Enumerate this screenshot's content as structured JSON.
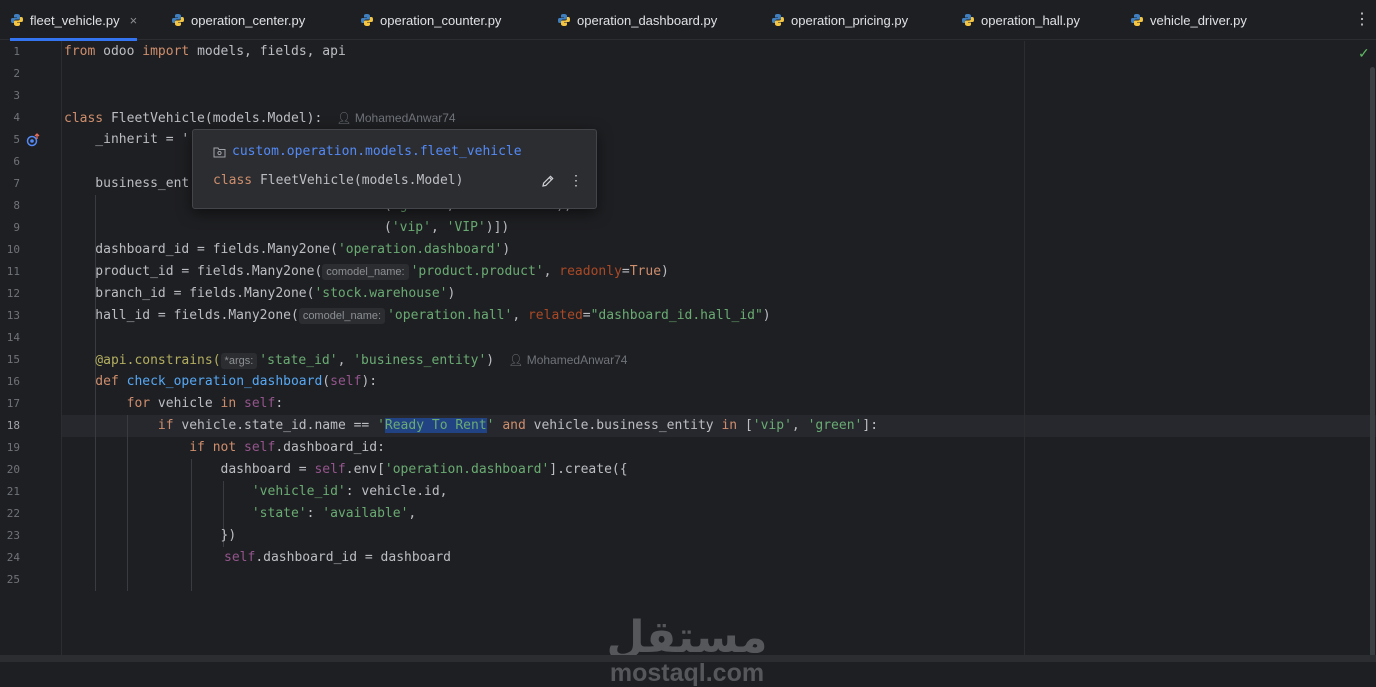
{
  "tabs": [
    {
      "label": "fleet_vehicle.py",
      "active": true,
      "close": "×"
    },
    {
      "label": "operation_center.py"
    },
    {
      "label": "operation_counter.py"
    },
    {
      "label": "operation_dashboard.py"
    },
    {
      "label": "operation_pricing.py"
    },
    {
      "label": "operation_hall.py"
    },
    {
      "label": "vehicle_driver.py"
    }
  ],
  "tabs_more": "⋮",
  "status_check": "✓",
  "line_numbers": [
    "1",
    "2",
    "3",
    "4",
    "5",
    "6",
    "7",
    "8",
    "9",
    "10",
    "11",
    "12",
    "13",
    "14",
    "15",
    "16",
    "17",
    "18",
    "19",
    "20",
    "21",
    "22",
    "23",
    "24",
    "25"
  ],
  "current_line": "18",
  "code": {
    "l1": {
      "from": "from",
      "mod": " odoo ",
      "imp": "import",
      "rest": " models, fields, api"
    },
    "l4": {
      "kw": "class",
      "rest": " FleetVehicle(models.Model):",
      "author": "MohamedAnwar74"
    },
    "l5": {
      "rest": "    _inherit = '"
    },
    "l7": {
      "rest": "    business_ent",
      "tail": ","
    },
    "l8": {
      "open": "(",
      "s1": "'green'",
      "comma": ", ",
      "s2": "'Green Taxi'",
      "close": "),"
    },
    "l9": {
      "open": "(",
      "s1": "'vip'",
      "comma": ", ",
      "s2": "'VIP'",
      "close": ")])"
    },
    "l10": {
      "a": "    dashboard_id = fields.Many2one(",
      "s": "'operation.dashboard'",
      "b": ")"
    },
    "l11": {
      "a": "    product_id = fields.Many2one(",
      "hint": "comodel_name:",
      "s": "'product.product'",
      "c": ", ",
      "p": "readonly",
      "eq": "=",
      "v": "True",
      "b": ")"
    },
    "l12": {
      "a": "    branch_id = fields.Many2one(",
      "s": "'stock.warehouse'",
      "b": ")"
    },
    "l13": {
      "a": "    hall_id = fields.Many2one(",
      "hint": "comodel_name:",
      "s": "'operation.hall'",
      "c": ", ",
      "p": "related",
      "eq": "=",
      "v": "\"dashboard_id.hall_id\"",
      "b": ")"
    },
    "l15": {
      "d": "    @api.constrains(",
      "hint": "*args:",
      "s1": "'state_id'",
      "c": ", ",
      "s2": "'business_entity'",
      "b": ")",
      "author": "MohamedAnwar74"
    },
    "l16": {
      "kw": "    def ",
      "fn": "check_operation_dashboard",
      "o": "(",
      "self": "self",
      "b": "):"
    },
    "l17": {
      "kw": "        for",
      "a": " vehicle ",
      "in": "in",
      "sp": " ",
      "self": "self",
      "b": ":"
    },
    "l18": {
      "kw": "            if",
      "a": " vehicle.state_id.name == ",
      "q1": "'",
      "sel": "Ready To Rent",
      "q2": "'",
      "sp": " ",
      "and": "and",
      "b": " vehicle.business_entity ",
      "in": "in",
      "c": " [",
      "s1": "'vip'",
      "cm": ", ",
      "s2": "'green'",
      "e": "]:"
    },
    "l19": {
      "kw": "                if not",
      "sp": " ",
      "self": "self",
      "b": ".dashboard_id:"
    },
    "l20": {
      "a": "                    dashboard = ",
      "self": "self",
      "b": ".env[",
      "s": "'operation.dashboard'",
      "c": "].create({"
    },
    "l21": {
      "s1": "                        'vehicle_id'",
      "b": ": vehicle.id,"
    },
    "l22": {
      "s1": "                        'state'",
      "b": ": ",
      "s2": "'available'",
      "c": ","
    },
    "l23": {
      "a": "                    })"
    },
    "l24": {
      "self": "self",
      "b": ".dashboard_id = dashboard"
    }
  },
  "popup": {
    "path": "custom.operation.models.fleet_vehicle",
    "decl_kw": "class",
    "decl_rest": " FleetVehicle(models.Model)",
    "menu": "⋮"
  },
  "watermark": {
    "arabic": "مستقل",
    "latin": "mostaql.com"
  }
}
